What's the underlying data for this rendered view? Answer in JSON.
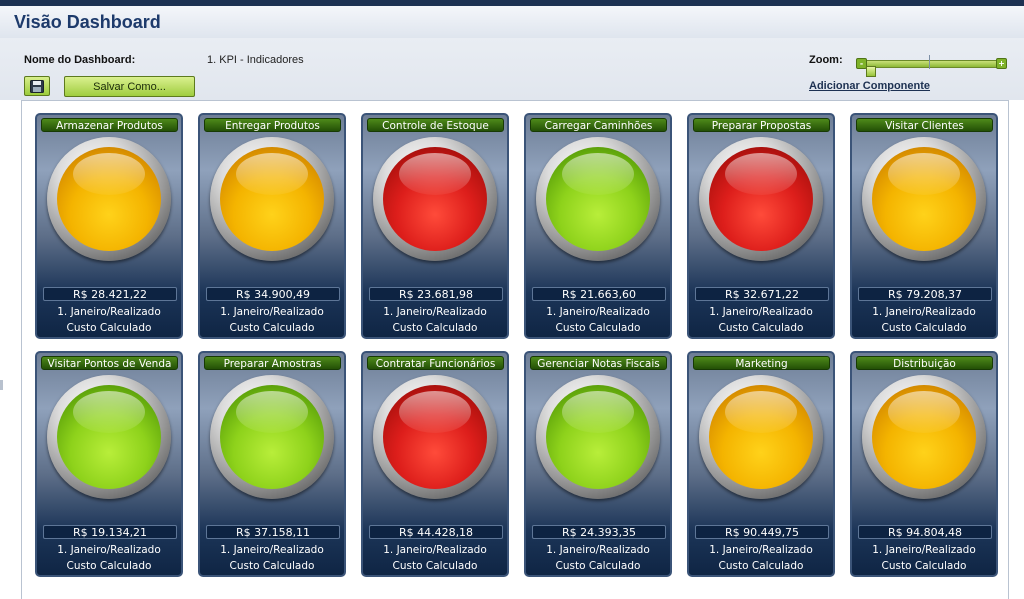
{
  "header": {
    "title": "Visão Dashboard"
  },
  "toolbar": {
    "name_label": "Nome do Dashboard:",
    "name_value": "1. KPI - Indicadores",
    "save_as_label": "Salvar Como...",
    "zoom_label": "Zoom:",
    "zoom_minus": "-",
    "zoom_plus": "+",
    "add_component_label": "Adicionar Componente"
  },
  "colors": {
    "amber": "#f4b400",
    "red": "#dd1e1b",
    "green": "#8ed21b",
    "title_green": "#2f6a0b",
    "navy": "#1d3152"
  },
  "cards": [
    {
      "title": "Armazenar Produtos",
      "status": "amber",
      "value": "R$ 28.421,22",
      "line1": "1. Janeiro/Realizado",
      "line2": "Custo Calculado"
    },
    {
      "title": "Entregar Produtos",
      "status": "amber",
      "value": "R$ 34.900,49",
      "line1": "1. Janeiro/Realizado",
      "line2": "Custo Calculado"
    },
    {
      "title": "Controle de Estoque",
      "status": "red",
      "value": "R$ 23.681,98",
      "line1": "1. Janeiro/Realizado",
      "line2": "Custo Calculado"
    },
    {
      "title": "Carregar Caminhões",
      "status": "green",
      "value": "R$ 21.663,60",
      "line1": "1. Janeiro/Realizado",
      "line2": "Custo Calculado"
    },
    {
      "title": "Preparar Propostas",
      "status": "red",
      "value": "R$ 32.671,22",
      "line1": "1. Janeiro/Realizado",
      "line2": "Custo Calculado"
    },
    {
      "title": "Visitar Clientes",
      "status": "amber",
      "value": "R$ 79.208,37",
      "line1": "1. Janeiro/Realizado",
      "line2": "Custo Calculado"
    },
    {
      "title": "Visitar Pontos de Venda",
      "status": "green",
      "value": "R$ 19.134,21",
      "line1": "1. Janeiro/Realizado",
      "line2": "Custo Calculado"
    },
    {
      "title": "Preparar Amostras",
      "status": "green",
      "value": "R$ 37.158,11",
      "line1": "1. Janeiro/Realizado",
      "line2": "Custo Calculado"
    },
    {
      "title": "Contratar Funcionários",
      "status": "red",
      "value": "R$ 44.428,18",
      "line1": "1. Janeiro/Realizado",
      "line2": "Custo Calculado"
    },
    {
      "title": "Gerenciar Notas Fiscais",
      "status": "green",
      "value": "R$ 24.393,35",
      "line1": "1. Janeiro/Realizado",
      "line2": "Custo Calculado"
    },
    {
      "title": "Marketing",
      "status": "amber",
      "value": "R$ 90.449,75",
      "line1": "1. Janeiro/Realizado",
      "line2": "Custo Calculado"
    },
    {
      "title": "Distribuição",
      "status": "amber",
      "value": "R$ 94.804,48",
      "line1": "1. Janeiro/Realizado",
      "line2": "Custo Calculado"
    }
  ]
}
